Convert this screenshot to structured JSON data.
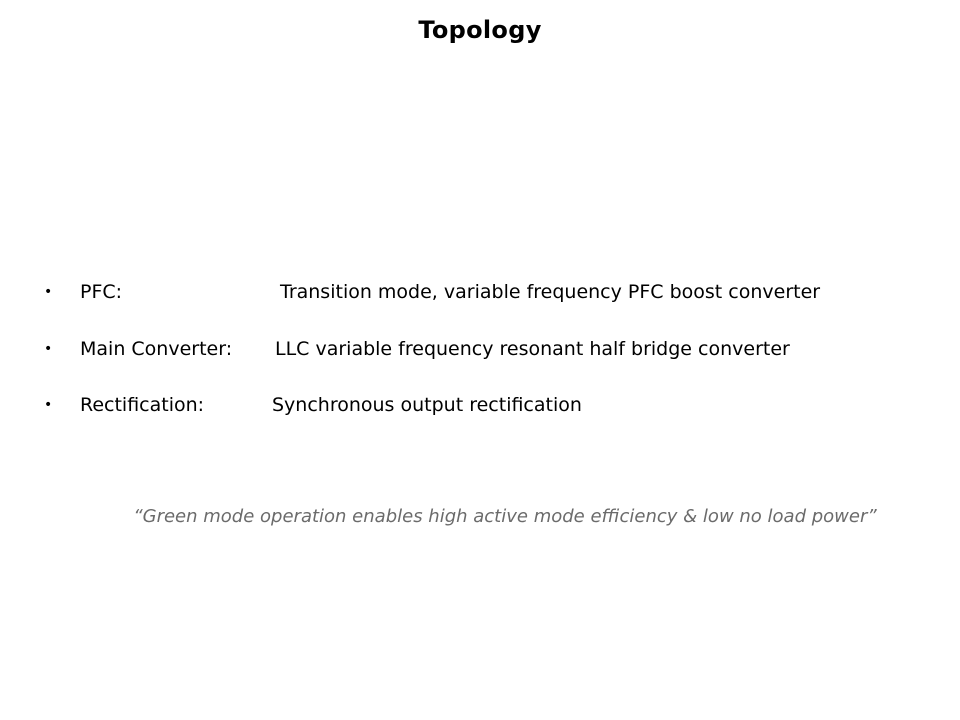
{
  "slide": {
    "title": "Topology",
    "bullets": [
      {
        "marker": "•",
        "label": "PFC:",
        "description": "Transition mode, variable frequency PFC boost converter"
      },
      {
        "marker": "•",
        "label": "Main Converter:",
        "description": "LLC variable frequency resonant half bridge converter"
      },
      {
        "marker": "•",
        "label": "Rectification:",
        "description": "Synchronous output rectification"
      }
    ],
    "quote": "“Green mode operation enables high active mode efficiency & low no load power”",
    "colors": {
      "text": "#000000",
      "quote": "#6b6b6b",
      "background": "#ffffff"
    }
  }
}
